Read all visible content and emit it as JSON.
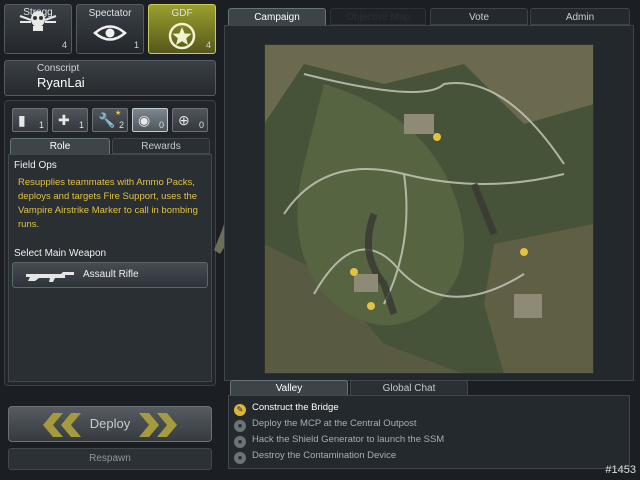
{
  "teams": [
    {
      "name": "Strogg",
      "count": "4",
      "icon": "strogg-skull-icon"
    },
    {
      "name": "Spectator",
      "count": "1",
      "icon": "eye-icon"
    },
    {
      "name": "GDF",
      "count": "4",
      "icon": "gdf-star-icon",
      "active": true
    }
  ],
  "player": {
    "rank": "Conscript",
    "name": "RyanLai"
  },
  "classes": [
    {
      "icon": "rifle-icon",
      "count": "1"
    },
    {
      "icon": "medic-cross-icon",
      "count": "1"
    },
    {
      "icon": "wrench-icon",
      "count": "2"
    },
    {
      "icon": "binoculars-icon",
      "count": "0",
      "active": true
    },
    {
      "icon": "crosshair-icon",
      "count": "0"
    }
  ],
  "class_tabs": {
    "role": "Role",
    "rewards": "Rewards"
  },
  "role": {
    "title": "Field Ops",
    "description": "Resupplies teammates with Ammo Packs, deploys and targets Fire Support, uses the Vampire Airstrike Marker to call in bombing runs."
  },
  "weapon": {
    "section_label": "Select Main Weapon",
    "selected": "Assault Rifle"
  },
  "actions": {
    "deploy": "Deploy",
    "respawn": "Respawn"
  },
  "top_tabs": {
    "campaign": "Campaign",
    "objectives": "Objective Map",
    "vote": "Vote",
    "admin": "Admin"
  },
  "bottom_tabs": {
    "map_name": "Valley",
    "chat": "Global Chat"
  },
  "objectives": [
    "Construct the Bridge",
    "Deploy the MCP at the Central Outpost",
    "Hack the Shield Generator to launch the SSM",
    "Destroy the Contamination Device"
  ],
  "frame_id": "#1453",
  "colors": {
    "accent_yellow": "#e2c240",
    "gdf_active": "#9a9f2f"
  }
}
